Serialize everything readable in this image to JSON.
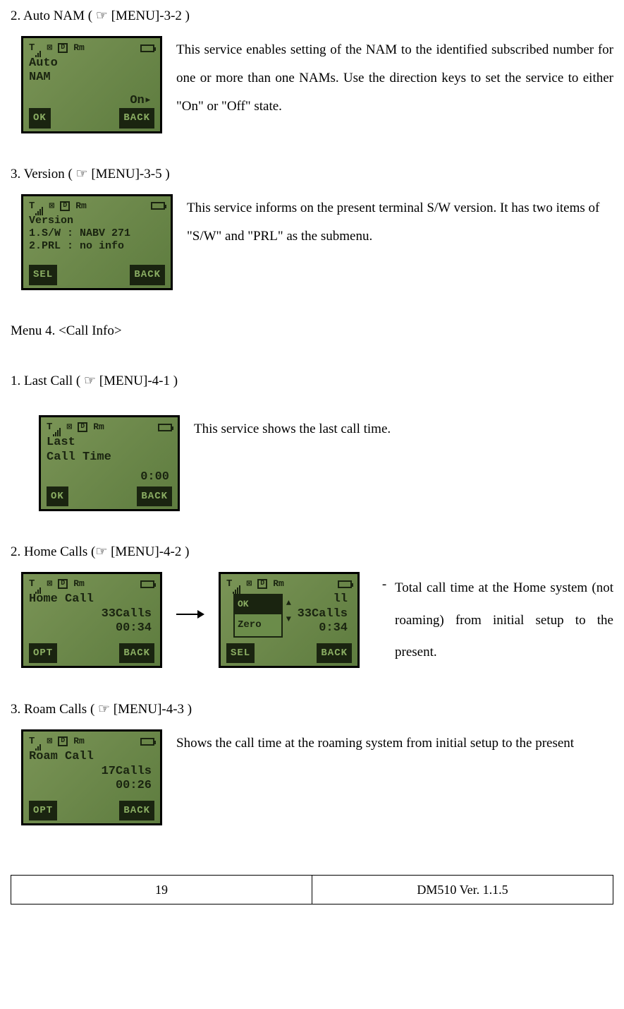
{
  "sections": {
    "autoNam": {
      "heading": "2. Auto NAM ( ☞ [MENU]-3-2 )",
      "description": "This service enables setting of the NAM to the identified subscribed number for one or more than one NAMs. Use the direction keys to set the service to either \"On\" or \"Off\" state.",
      "screen": {
        "line1": "Auto",
        "line2": "NAM",
        "right": "On▸",
        "softLeft": "OK",
        "softRight": "BACK"
      }
    },
    "version": {
      "heading": "3. Version ( ☞ [MENU]-3-5 )",
      "description": "This service informs on the present terminal S/W version. It has two items of \"S/W\" and \"PRL\" as the submenu.",
      "screen": {
        "line1": "Version",
        "line2": "1.S/W : NABV 271",
        "line3": "2.PRL : no info",
        "softLeft": "SEL",
        "softRight": "BACK"
      }
    },
    "menuHeading": "Menu 4. <Call Info>",
    "lastCall": {
      "heading": "1. Last Call ( ☞ [MENU]-4-1 )",
      "description": "This service shows the last call time.",
      "screen": {
        "line1": "Last",
        "line2": "Call Time",
        "right": "0:00",
        "softLeft": "OK",
        "softRight": "BACK"
      }
    },
    "homeCalls": {
      "heading": "2. Home Calls (☞ [MENU]-4-2 )",
      "bullet": "Total call time at the Home system (not roaming) from initial setup to the present.",
      "screen1": {
        "line1": "Home Call",
        "line2": "33Calls",
        "line3": "00:34",
        "softLeft": "OPT",
        "softRight": "BACK"
      },
      "screen2": {
        "line1": "ll",
        "line2": "33Calls",
        "line3": "0:34",
        "popupOk": "OK",
        "popupText": "Zero",
        "softLeft": "SEL",
        "softRight": "BACK"
      }
    },
    "roamCalls": {
      "heading": "3. Roam Calls ( ☞ [MENU]-4-3 )",
      "description": "Shows the call time at the roaming system from initial setup to the present",
      "screen": {
        "line1": "Roam Call",
        "line2": "17Calls",
        "line3": "00:26",
        "softLeft": "OPT",
        "softRight": "BACK"
      }
    }
  },
  "statusIcons": {
    "envelope": "⊠",
    "d": "D",
    "rm": "Rm"
  },
  "footer": {
    "page": "19",
    "doc": "DM510    Ver. 1.1.5"
  }
}
